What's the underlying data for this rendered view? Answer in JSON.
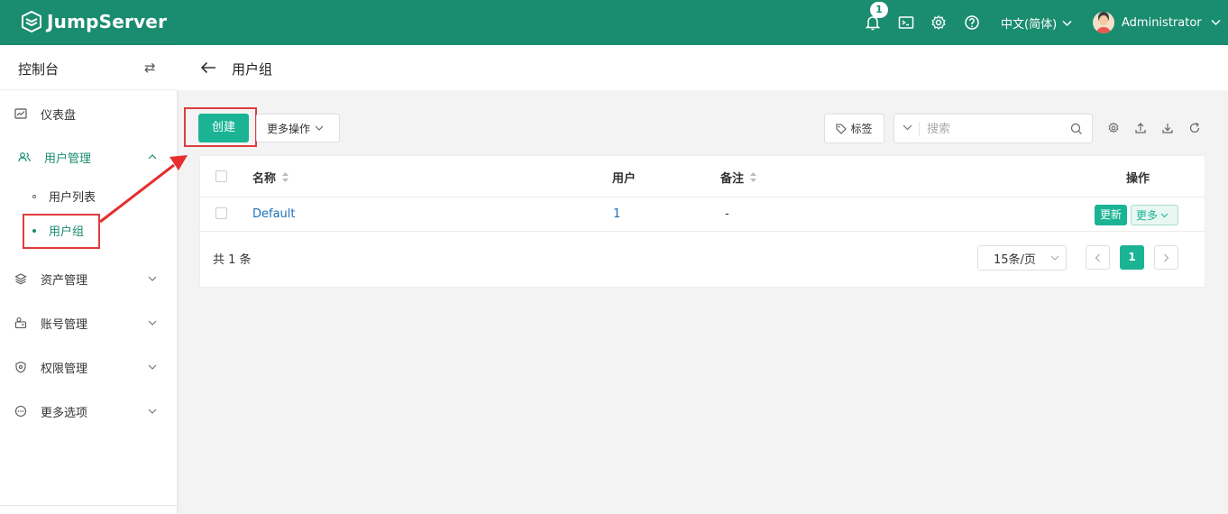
{
  "app": {
    "logo_text": "JumpServer",
    "notification_count": "1",
    "language": "中文(简体)",
    "username": "Administrator"
  },
  "sidebar": {
    "title": "控制台",
    "items": [
      {
        "label": "仪表盘",
        "icon": "dashboard-icon"
      },
      {
        "label": "用户管理",
        "icon": "users-icon",
        "expanded": true
      },
      {
        "label": "资产管理",
        "icon": "layers-icon"
      },
      {
        "label": "账号管理",
        "icon": "accounts-icon"
      },
      {
        "label": "权限管理",
        "icon": "shield-icon"
      },
      {
        "label": "更多选项",
        "icon": "more-circle-icon"
      }
    ],
    "subitems": [
      {
        "label": "用户列表"
      },
      {
        "label": "用户组",
        "active": true
      }
    ]
  },
  "page": {
    "title": "用户组"
  },
  "toolbar": {
    "create_label": "创建",
    "more_actions_label": "更多操作",
    "tags_label": "标签",
    "search_placeholder": "搜索"
  },
  "table": {
    "columns": {
      "name": "名称",
      "users": "用户",
      "comment": "备注",
      "actions": "操作"
    },
    "rows": [
      {
        "name": "Default",
        "users": "1",
        "comment": "-",
        "update_label": "更新",
        "more_label": "更多"
      }
    ]
  },
  "pagination": {
    "total_text": "共 1 条",
    "page_size": "15条/页",
    "current_page": "1"
  },
  "colors": {
    "header_bg": "#1a8c70",
    "accent": "#1ab394",
    "highlight": "#e03c3c"
  }
}
